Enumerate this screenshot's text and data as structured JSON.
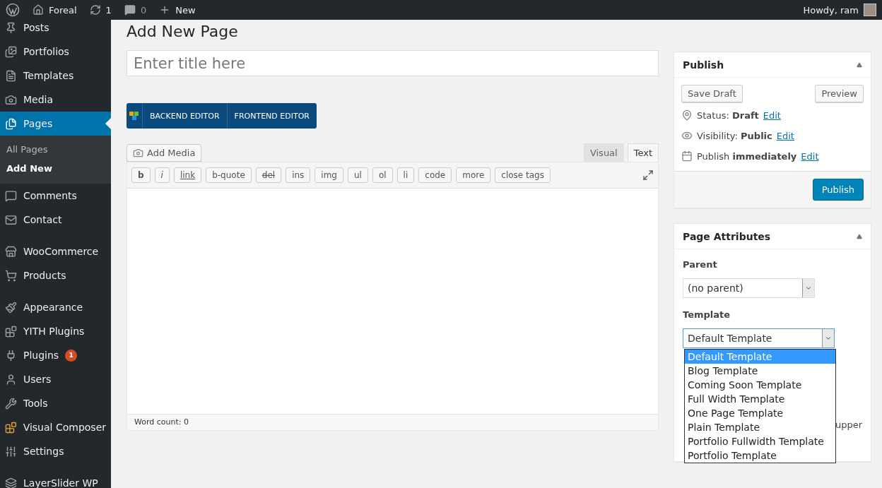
{
  "admin_bar": {
    "site": "Foreal",
    "updates": "1",
    "comments": "0",
    "new": "New",
    "greeting": "Howdy, ram"
  },
  "sidebar": {
    "groups": [
      [
        {
          "label": "Posts",
          "selected": false
        },
        {
          "label": "Portfolios",
          "selected": false
        },
        {
          "label": "Templates",
          "selected": false
        },
        {
          "label": "Media",
          "selected": false
        },
        {
          "label": "Pages",
          "selected": true,
          "children": [
            {
              "label": "All Pages",
              "selected": false
            },
            {
              "label": "Add New",
              "selected": true
            }
          ]
        },
        {
          "label": "Comments",
          "selected": false
        },
        {
          "label": "Contact",
          "selected": false
        }
      ],
      [
        {
          "label": "WooCommerce",
          "selected": false
        },
        {
          "label": "Products",
          "selected": false
        }
      ],
      [
        {
          "label": "Appearance",
          "selected": false
        },
        {
          "label": "YITH Plugins",
          "selected": false
        },
        {
          "label": "Plugins",
          "selected": false,
          "badge": "1"
        },
        {
          "label": "Users",
          "selected": false
        },
        {
          "label": "Tools",
          "selected": false
        },
        {
          "label": "Visual Composer",
          "selected": false
        },
        {
          "label": "Settings",
          "selected": false
        }
      ],
      [
        {
          "label": "LayerSlider WP",
          "selected": false
        }
      ]
    ]
  },
  "page_title": "Add New Page",
  "title_field": {
    "placeholder": "Enter title here"
  },
  "composer": {
    "buttons": [
      "BACKEND EDITOR",
      "FRONTEND EDITOR"
    ]
  },
  "editor": {
    "add_media": "Add Media",
    "tabs": [
      {
        "label": "Visual",
        "selected": false
      },
      {
        "label": "Text",
        "selected": true
      }
    ],
    "toolbar": [
      {
        "label": "b",
        "kind": "bold"
      },
      {
        "label": "i",
        "kind": "italic"
      },
      {
        "label": "link",
        "kind": "underline"
      },
      {
        "label": "b-quote",
        "kind": "plain"
      },
      {
        "label": "del",
        "kind": "strike"
      },
      {
        "label": "ins",
        "kind": "plain"
      },
      {
        "label": "img",
        "kind": "plain"
      },
      {
        "label": "ul",
        "kind": "plain"
      },
      {
        "label": "ol",
        "kind": "plain"
      },
      {
        "label": "li",
        "kind": "plain"
      },
      {
        "label": "code",
        "kind": "plain"
      },
      {
        "label": "more",
        "kind": "plain"
      },
      {
        "label": "close tags",
        "kind": "plain"
      }
    ],
    "word_count": "Word count: 0"
  },
  "publish_box": {
    "title": "Publish",
    "save_draft": "Save Draft",
    "preview": "Preview",
    "rows": [
      {
        "kind": "status",
        "text": "Status: **Draft**",
        "link": "Edit"
      },
      {
        "kind": "visibility",
        "text": "Visibility: **Public**",
        "link": "Edit"
      },
      {
        "kind": "schedule",
        "text": "Publish **immediately**",
        "link": "Edit"
      }
    ],
    "publish": "Publish"
  },
  "attributes_box": {
    "title": "Page Attributes",
    "parent_label": "Parent",
    "parent_value": "(no parent)",
    "template_label": "Template",
    "template_value": "Default Template",
    "template_options": [
      {
        "label": "Default Template",
        "selected": true
      },
      {
        "label": "Blog Template",
        "selected": false
      },
      {
        "label": "Coming Soon Template",
        "selected": false
      },
      {
        "label": "Full Width Template",
        "selected": false
      },
      {
        "label": "One Page Template",
        "selected": false
      },
      {
        "label": "Plain Template",
        "selected": false
      },
      {
        "label": "Portfolio Fullwidth Template",
        "selected": false
      },
      {
        "label": "Portfolio Template",
        "selected": false
      }
    ],
    "hidden_text": "upper"
  }
}
